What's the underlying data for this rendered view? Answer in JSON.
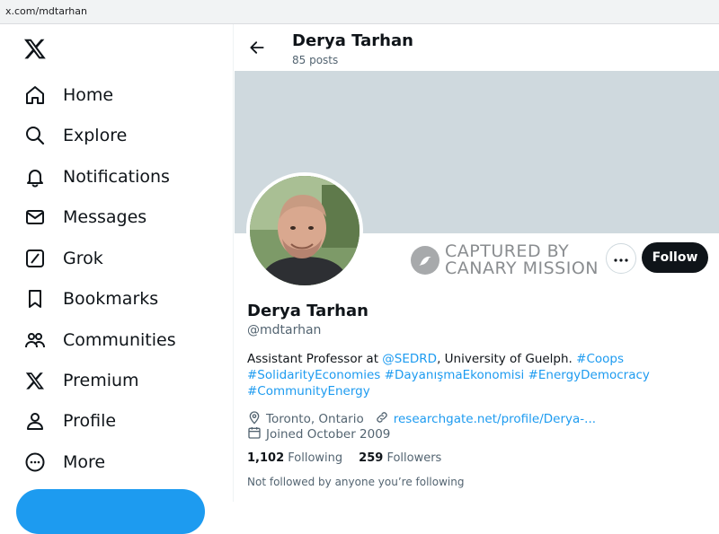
{
  "browser": {
    "url": "x.com/mdtarhan"
  },
  "sidebar": {
    "items": [
      {
        "label": "Home",
        "icon": "home-icon"
      },
      {
        "label": "Explore",
        "icon": "search-icon"
      },
      {
        "label": "Notifications",
        "icon": "bell-icon"
      },
      {
        "label": "Messages",
        "icon": "envelope-icon"
      },
      {
        "label": "Grok",
        "icon": "grok-icon"
      },
      {
        "label": "Bookmarks",
        "icon": "bookmark-icon"
      },
      {
        "label": "Communities",
        "icon": "people-icon"
      },
      {
        "label": "Premium",
        "icon": "x-logo-icon"
      },
      {
        "label": "Profile",
        "icon": "person-icon"
      },
      {
        "label": "More",
        "icon": "more-circle-icon"
      }
    ]
  },
  "header": {
    "name": "Derya Tarhan",
    "posts": "85 posts"
  },
  "stamp": {
    "text_line1": "CAPTURED BY",
    "text_line2": "CANARY MISSION"
  },
  "profile": {
    "follow_label": "Follow",
    "name": "Derya Tarhan",
    "handle": "@mdtarhan",
    "bio": {
      "t1": "Assistant Professor at ",
      "l1": "@SEDRD",
      "t2": ", University of Guelph. ",
      "l2": "#Coops",
      "l3": "#SolidarityEconomies",
      "l4": "#DayanışmaEkonomisi",
      "l5": "#EnergyDemocracy",
      "l6": "#CommunityEnergy"
    },
    "location": "Toronto, Ontario",
    "website": "researchgate.net/profile/Derya-...",
    "joined": "Joined October 2009",
    "following_count": "1,102",
    "following_label": "Following",
    "followers_count": "259",
    "followers_label": "Followers",
    "not_followed": "Not followed by anyone you’re following"
  },
  "colors": {
    "accent": "#1d9bf0",
    "text": "#0f1419",
    "secondary": "#536471",
    "banner": "#cfd9de"
  }
}
